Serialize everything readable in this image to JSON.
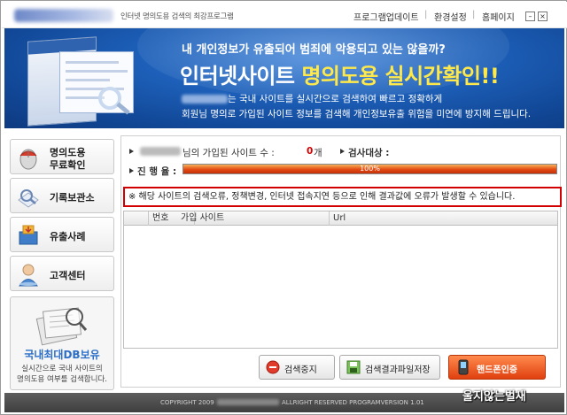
{
  "titlebar": {
    "app_title": "인터넷 명의도용 검색의 최강프로그램",
    "links": [
      "프로그램업데이트",
      "환경설정",
      "홈페이지"
    ],
    "minimize_label": "–",
    "close_label": "×"
  },
  "banner": {
    "line1": "내 개인정보가 유출되어 범죄에 악용되고 있는 않을까?",
    "line2_a": "인터넷사이트 ",
    "line2_b": "명의도용 실시간확인!!",
    "line3": "는 국내 사이트를 실시간으로 검색하여 빠르고 정확하게",
    "line4": "회원님 명의로 가입된 사이트 정보를 검색해 개인정보유출 위험을 미연에 방지해 드립니다."
  },
  "sidebar": {
    "items": [
      {
        "line1": "명의도용",
        "line2": "무료확인",
        "icon": "mouse-icon"
      },
      {
        "label": "기록보관소",
        "icon": "magnifier-icon"
      },
      {
        "label": "유출사례",
        "icon": "mailbox-icon"
      },
      {
        "label": "고객센터",
        "icon": "support-person-icon"
      }
    ],
    "promo": {
      "title": "국내최대DB보유",
      "text1": "실시간으로 국내 사이트의",
      "text2": "명의도용 여부를 검색합니다."
    }
  },
  "status": {
    "user_suffix": "님의 가입된 사이트 수 :",
    "site_count": "0",
    "count_unit": "개",
    "target_label": "검사대상 :",
    "progress_label": "진 행 율 :",
    "progress_value": 1.0,
    "progress_text": "100%"
  },
  "warning": "※ 해당 사이트의 검색오류, 정책변경, 인터넷  접속지연 등으로 인해 결과값에 오류가 발생할 수 있습니다.",
  "table": {
    "columns": [
      "번호",
      "가입 사이트",
      "Url"
    ]
  },
  "actions": {
    "stop_label": "검색중지",
    "save_label": "검색결과파일저장",
    "phone_label": "핸드폰인증"
  },
  "footer": {
    "copyright": "COPYRIGHT 2009",
    "rights": "ALLRIGHT RESERVED  PROGRAMVERSION 1.01"
  },
  "watermark": "울지않는벌새",
  "colors": {
    "banner_blue": "#1d5fb8",
    "highlight_yellow": "#ffe94a",
    "count_red": "#d20000",
    "warning_border": "#d20000",
    "progress_orange": "#e34a12",
    "promo_blue": "#2d6fc8"
  }
}
